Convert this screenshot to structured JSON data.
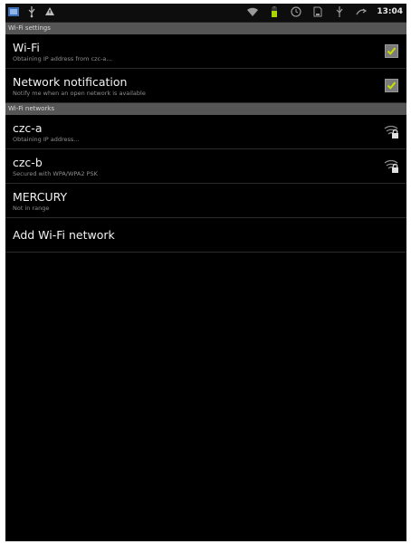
{
  "status_bar": {
    "time": "13:04",
    "icons": [
      "app-icon",
      "usb-icon",
      "warning-icon",
      "wifi-icon",
      "battery-icon",
      "clock-icon",
      "sd-card-icon",
      "usb-icon",
      "signal-icon"
    ]
  },
  "sections": {
    "wifi_settings": {
      "header": "Wi-Fi settings"
    },
    "wifi_networks": {
      "header": "Wi-Fi networks"
    }
  },
  "settings": {
    "wifi": {
      "title": "Wi-Fi",
      "summary": "Obtaining IP address from czc-a...",
      "checked": true
    },
    "network_notification": {
      "title": "Network notification",
      "summary": "Notify me when an open network is available",
      "checked": true
    }
  },
  "networks": [
    {
      "name": "czc-a",
      "status": "Obtaining IP address...",
      "icon": "wifi-lock-icon"
    },
    {
      "name": "czc-b",
      "status": "Secured with WPA/WPA2 PSK",
      "icon": "wifi-lock-icon"
    },
    {
      "name": "MERCURY",
      "status": "Not in range"
    }
  ],
  "add_network": {
    "label": "Add Wi-Fi network"
  },
  "colors": {
    "accent_check": "#c8e000",
    "section_header_bg": "#555555",
    "background": "#000000"
  }
}
